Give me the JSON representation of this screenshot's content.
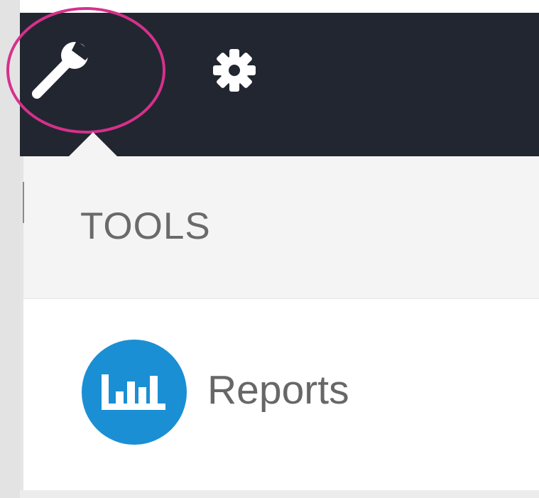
{
  "navbar": {
    "background": "#222630",
    "icons": [
      "wrench-icon",
      "gear-icon"
    ],
    "active_icon_highlight": "#d6308c"
  },
  "dropdown": {
    "header": "TOOLS",
    "items": [
      {
        "label": "Reports",
        "icon": "bar-chart-icon",
        "icon_color": "#1a8fd4"
      }
    ]
  }
}
